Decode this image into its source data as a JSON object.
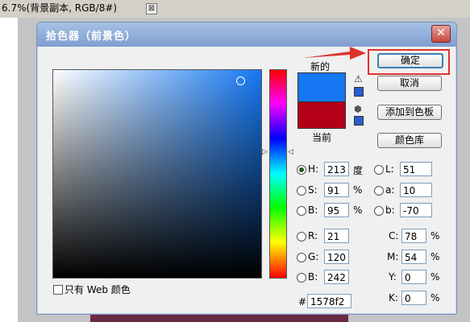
{
  "bg": {
    "tab_title": "6.7%(背景副本, RGB/8#)",
    "tab_close": "⊠"
  },
  "dialog": {
    "title": "拾色器（前景色）",
    "close": "✕",
    "new_label": "新的",
    "current_label": "当前",
    "new_color": "#1578f2",
    "current_color": "#b30018"
  },
  "buttons": {
    "ok": "确定",
    "cancel": "取消",
    "add_swatch": "添加到色板",
    "color_library": "颜色库"
  },
  "hsb": {
    "h": {
      "label": "H:",
      "value": "213",
      "unit": "度"
    },
    "s": {
      "label": "S:",
      "value": "91",
      "unit": "%"
    },
    "b": {
      "label": "B:",
      "value": "95",
      "unit": "%"
    }
  },
  "lab": {
    "l": {
      "label": "L:",
      "value": "51"
    },
    "a": {
      "label": "a:",
      "value": "10"
    },
    "b": {
      "label": "b:",
      "value": "-70"
    }
  },
  "rgb": {
    "r": {
      "label": "R:",
      "value": "21"
    },
    "g": {
      "label": "G:",
      "value": "120"
    },
    "b": {
      "label": "B:",
      "value": "242"
    }
  },
  "cmyk": {
    "c": {
      "label": "C:",
      "value": "78",
      "unit": "%"
    },
    "m": {
      "label": "M:",
      "value": "54",
      "unit": "%"
    },
    "y": {
      "label": "Y:",
      "value": "0",
      "unit": "%"
    },
    "k": {
      "label": "K:",
      "value": "0",
      "unit": "%"
    }
  },
  "hex": {
    "label": "#",
    "value": "1578f2"
  },
  "web_only": {
    "label": "只有 Web 颜色",
    "checked": false
  }
}
